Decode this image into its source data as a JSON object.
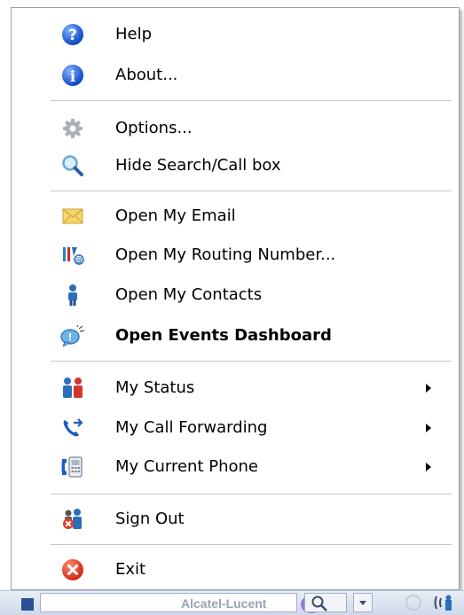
{
  "menu": {
    "items": [
      {
        "label": "Help",
        "icon": "help-icon"
      },
      {
        "label": "About...",
        "icon": "info-icon"
      },
      {
        "label": "Options...",
        "icon": "gear-icon"
      },
      {
        "label": "Hide Search/Call box",
        "icon": "magnifier-icon"
      },
      {
        "label": "Open My Email",
        "icon": "envelope-icon"
      },
      {
        "label": "Open My Routing Number...",
        "icon": "routing-number-icon"
      },
      {
        "label": "Open My Contacts",
        "icon": "contact-person-icon"
      },
      {
        "label": "Open Events Dashboard",
        "icon": "events-dashboard-icon",
        "bold": true
      },
      {
        "label": "My Status",
        "icon": "status-people-icon",
        "submenu": true
      },
      {
        "label": "My Call Forwarding",
        "icon": "call-forward-icon",
        "submenu": true
      },
      {
        "label": "My Current Phone",
        "icon": "current-phone-icon",
        "submenu": true
      },
      {
        "label": "Sign Out",
        "icon": "sign-out-icon"
      },
      {
        "label": "Exit",
        "icon": "exit-icon"
      }
    ]
  },
  "taskbar": {
    "logo_text": "Alcatel-Lucent"
  },
  "colors": {
    "help_blue": "#1f5fd6",
    "exit_red": "#e0402a",
    "separator": "#c8c8c8"
  }
}
